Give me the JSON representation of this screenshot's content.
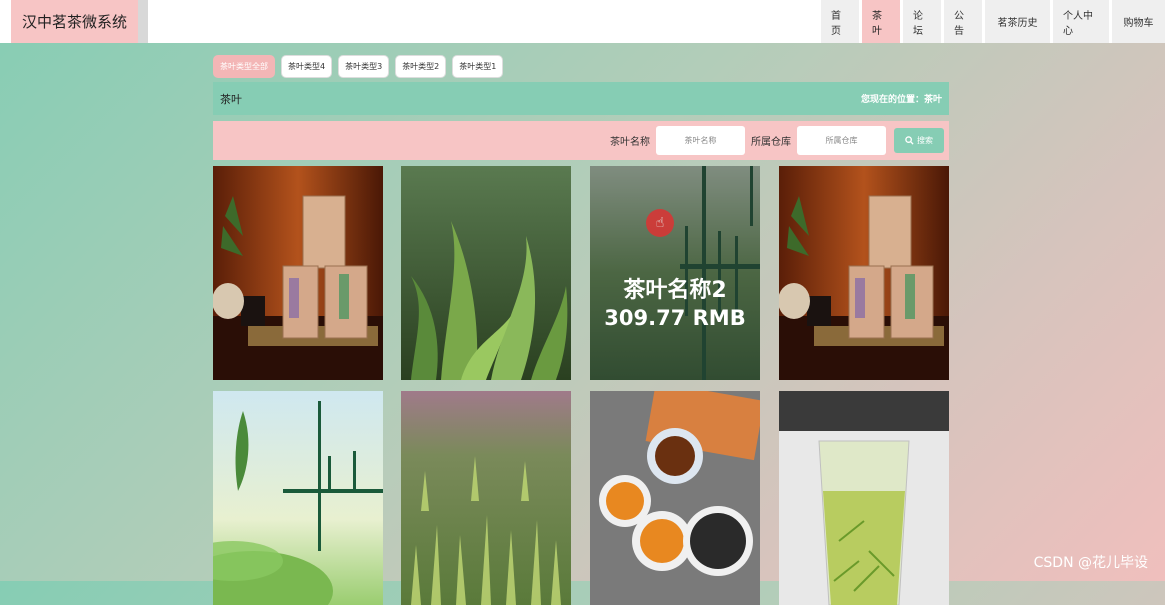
{
  "brand": "汉中茗茶微系统",
  "nav": [
    "首页",
    "茶叶",
    "论坛",
    "公告",
    "茗茶历史",
    "个人中心",
    "购物车"
  ],
  "nav_active": 1,
  "categories": [
    "茶叶类型全部",
    "茶叶类型4",
    "茶叶类型3",
    "茶叶类型2",
    "茶叶类型1"
  ],
  "category_active": 0,
  "crumb": {
    "title": "茶叶",
    "location": "您现在的位置：茶叶"
  },
  "search": {
    "name_label": "茶叶名称",
    "name_placeholder": "茶叶名称",
    "warehouse_label": "所属仓库",
    "warehouse_placeholder": "所属仓库",
    "button": "搜索"
  },
  "products": [
    {
      "image": "tea-tins",
      "hover": false
    },
    {
      "image": "tea-leaves-closeup",
      "hover": false
    },
    {
      "image": "tea-poster-green",
      "hover": true,
      "name": "茶叶名称2",
      "price": "309.77 RMB"
    },
    {
      "image": "tea-tins",
      "hover": false
    },
    {
      "image": "tea-plantation-poster",
      "hover": false
    },
    {
      "image": "tea-field",
      "hover": false
    },
    {
      "image": "tea-cups",
      "hover": false
    },
    {
      "image": "tea-glass",
      "hover": false
    }
  ],
  "watermark": "CSDN @花儿毕设"
}
